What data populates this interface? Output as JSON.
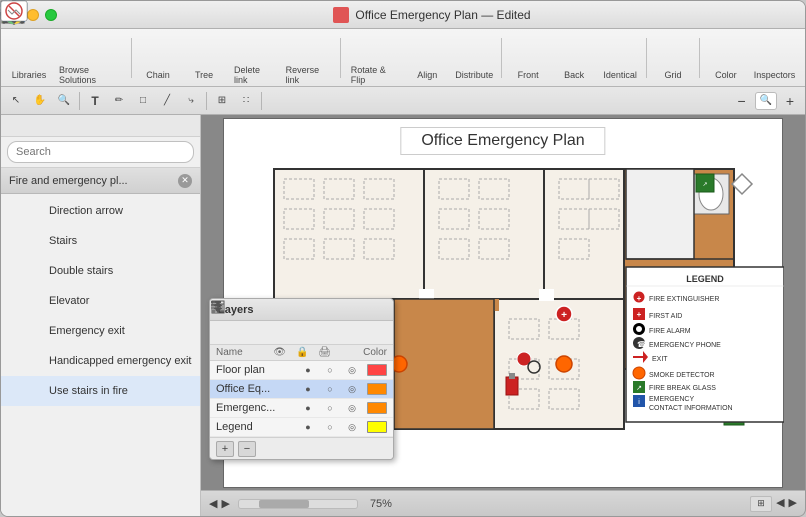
{
  "titlebar": {
    "title": "Office Emergency Plan",
    "subtitle": "Edited"
  },
  "toolbar": {
    "items": [
      {
        "id": "libraries",
        "label": "Libraries"
      },
      {
        "id": "browse",
        "label": "Browse Solutions"
      },
      {
        "id": "chain",
        "label": "Chain"
      },
      {
        "id": "tree",
        "label": "Tree"
      },
      {
        "id": "delete-link",
        "label": "Delete link"
      },
      {
        "id": "reverse-link",
        "label": "Reverse link"
      },
      {
        "id": "rotate-flip",
        "label": "Rotate & Flip"
      },
      {
        "id": "align",
        "label": "Align"
      },
      {
        "id": "distribute",
        "label": "Distribute"
      },
      {
        "id": "front",
        "label": "Front"
      },
      {
        "id": "back",
        "label": "Back"
      },
      {
        "id": "identical",
        "label": "Identical"
      },
      {
        "id": "grid",
        "label": "Grid"
      },
      {
        "id": "color",
        "label": "Color"
      },
      {
        "id": "inspectors",
        "label": "Inspectors"
      }
    ]
  },
  "search": {
    "placeholder": "Search"
  },
  "library": {
    "title": "Fire and emergency pl...",
    "items": [
      {
        "id": "direction-arrow",
        "label": "Direction arrow"
      },
      {
        "id": "stairs",
        "label": "Stairs"
      },
      {
        "id": "double-stairs",
        "label": "Double stairs"
      },
      {
        "id": "elevator",
        "label": "Elevator"
      },
      {
        "id": "emergency-exit",
        "label": "Emergency exit"
      },
      {
        "id": "handicapped-exit",
        "label": "Handicapped emergency exit"
      },
      {
        "id": "use-stairs",
        "label": "Use stairs in fire"
      }
    ]
  },
  "canvas": {
    "title": "Office Emergency Plan",
    "zoom": "75%"
  },
  "layers": {
    "title": "Layers",
    "header": {
      "name": "Name",
      "icons": [
        "eye",
        "lock",
        "print",
        "color"
      ]
    },
    "items": [
      {
        "name": "Floor plan",
        "visible": true,
        "locked": false,
        "print": true,
        "color": "#ff4444",
        "selected": false
      },
      {
        "name": "Office Eq...",
        "visible": true,
        "locked": false,
        "print": true,
        "color": "#ff8800",
        "selected": true
      },
      {
        "name": "Emergenc...",
        "visible": true,
        "locked": false,
        "print": true,
        "color": "#ff8800",
        "selected": false
      },
      {
        "name": "Legend",
        "visible": true,
        "locked": false,
        "print": true,
        "color": "#ffff00",
        "selected": false
      }
    ]
  },
  "legend": {
    "title": "LEGEND",
    "items": [
      {
        "label": "FIRE EXTINGUISHER"
      },
      {
        "label": "FIRST AID"
      },
      {
        "label": "FIRE ALARM"
      },
      {
        "label": "EMERGENCY PHONE"
      },
      {
        "label": "EXIT"
      },
      {
        "label": "SMOKE DETECTOR"
      },
      {
        "label": "FIRE BREAK GLASS"
      },
      {
        "label": "EMERGENCY CONTACT INFORMATION"
      }
    ]
  }
}
